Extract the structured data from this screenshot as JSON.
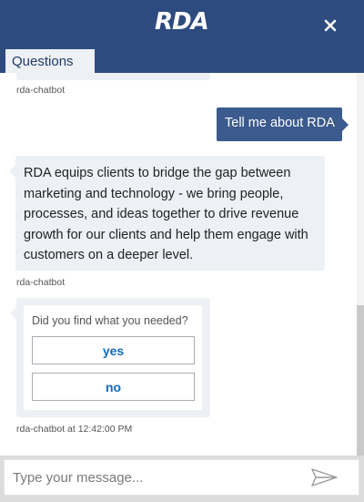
{
  "header": {
    "logo_text": "RDA",
    "close_icon": "close-icon",
    "background": "#2d4b7f"
  },
  "tab": {
    "label": "Questions"
  },
  "messages": {
    "prev_sender": "rda-chatbot",
    "user_message": "Tell me about RDA",
    "bot_message": "RDA equips clients to bridge the gap between marketing and technology - we bring people, processes, and ideas together to drive revenue growth for our clients and help them engage with customers on a deeper level.",
    "bot_sender": "rda-chatbot",
    "card": {
      "question": "Did you find what you needed?",
      "options": [
        "yes",
        "no"
      ]
    },
    "card_sender": "rda-chatbot at 12:42:00 PM"
  },
  "composer": {
    "placeholder": "Type your message...",
    "send_icon": "send-icon"
  },
  "colors": {
    "brand": "#2d4b7f",
    "user_bubble": "#3b5a8d",
    "bot_bubble": "#edf0f4",
    "link": "#0f6cbd"
  }
}
